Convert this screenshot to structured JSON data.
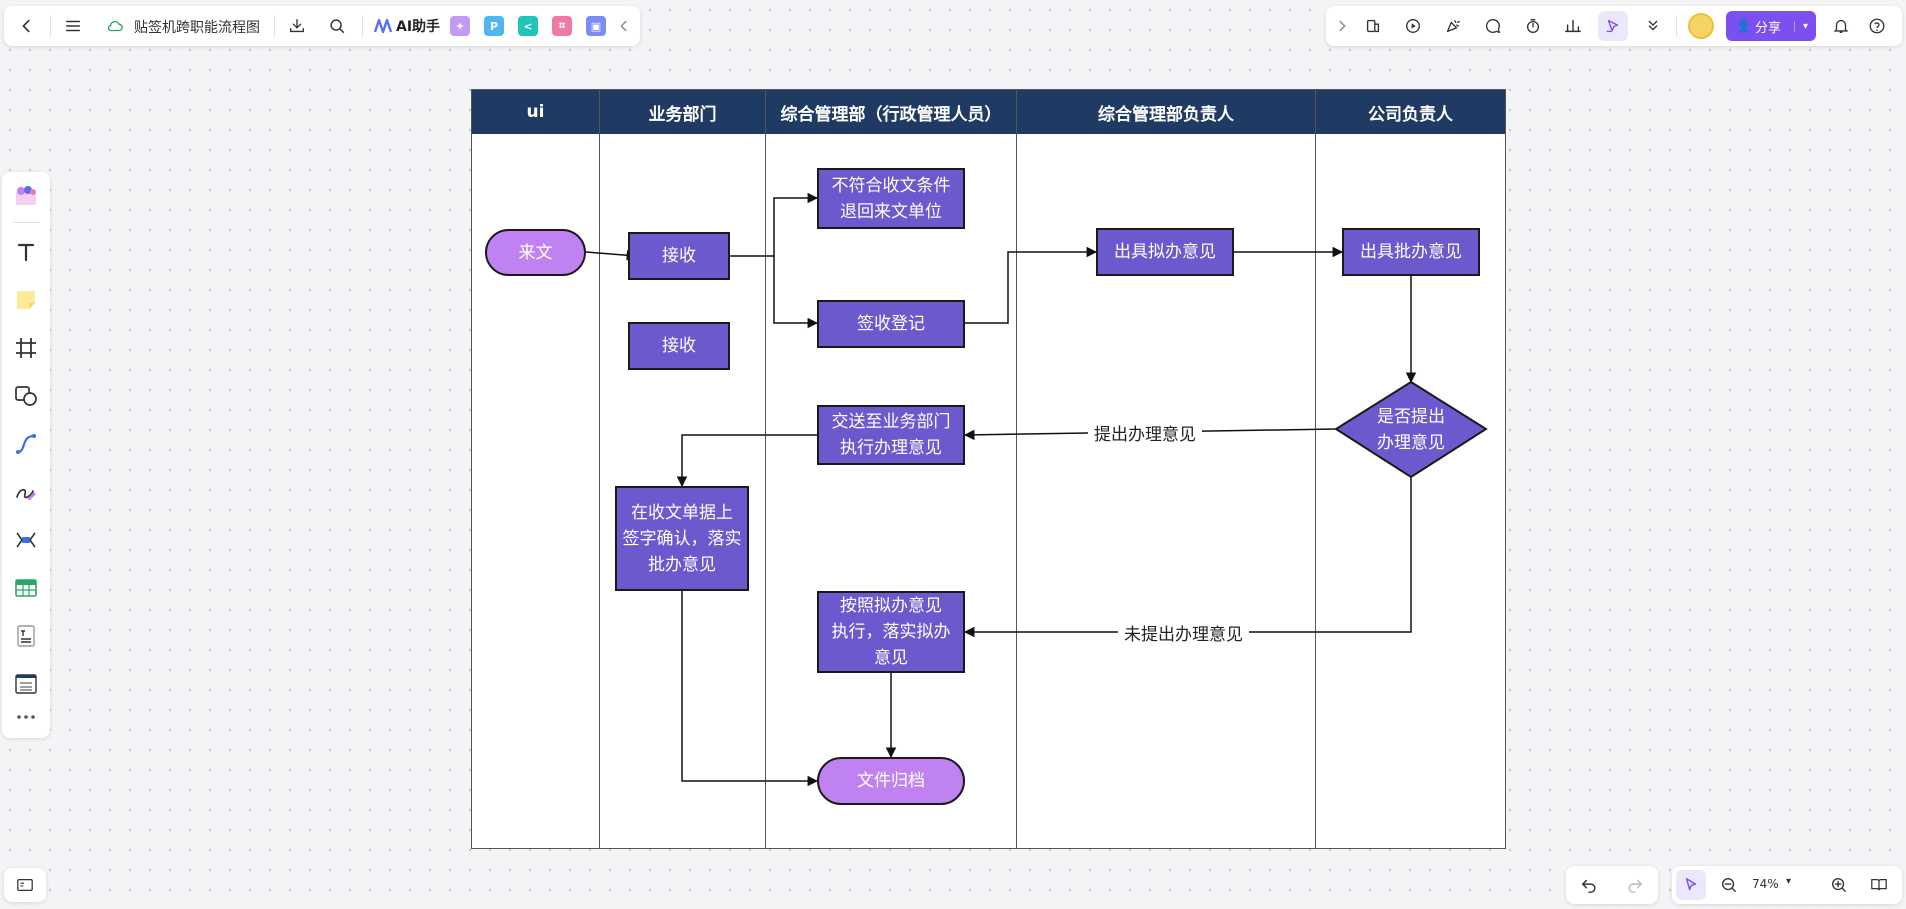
{
  "top_bar": {
    "doc_title": "贴签机跨职能流程图",
    "ai_label": "AI助手",
    "mini_apps": [
      {
        "name": "image-app",
        "color": "#c39cf2",
        "glyph": "✦"
      },
      {
        "name": "p-app",
        "color": "#4fb6f0",
        "glyph": "P"
      },
      {
        "name": "mindmap-app",
        "color": "#23c4b8",
        "glyph": "<"
      },
      {
        "name": "flow-app",
        "color": "#f07aa6",
        "glyph": "⌗"
      },
      {
        "name": "chat-app",
        "color": "#7b8cf5",
        "glyph": "▣"
      }
    ]
  },
  "right_bar": {
    "share_label": "分享"
  },
  "zoom": {
    "value": "74%"
  },
  "lanes": [
    {
      "title": "ui"
    },
    {
      "title": "业务部门"
    },
    {
      "title": "综合管理部（行政管理人员）"
    },
    {
      "title": "综合管理部负责人"
    },
    {
      "title": "公司负责人"
    }
  ],
  "nodes": {
    "laiwen": "来文",
    "jieshou1": "接收",
    "jieshou2": "接收",
    "bufuhe": "不符合收文条件\n退回来文单位",
    "qianshou": "签收登记",
    "chuju_niban": "出具拟办意见",
    "chuju_piban": "出具批办意见",
    "shifou": "是否提出\n办理意见",
    "jiaosong": "交送至业务部门\n执行办理意见",
    "zaishouwen": "在收文单据上\n签字确认，落实\n批办意见",
    "anzhao": "按照拟办意见\n执行，落实拟办\n意见",
    "guidang": "文件归档"
  },
  "edge_labels": {
    "yes": "提出办理意见",
    "no": "未提出办理意见"
  }
}
